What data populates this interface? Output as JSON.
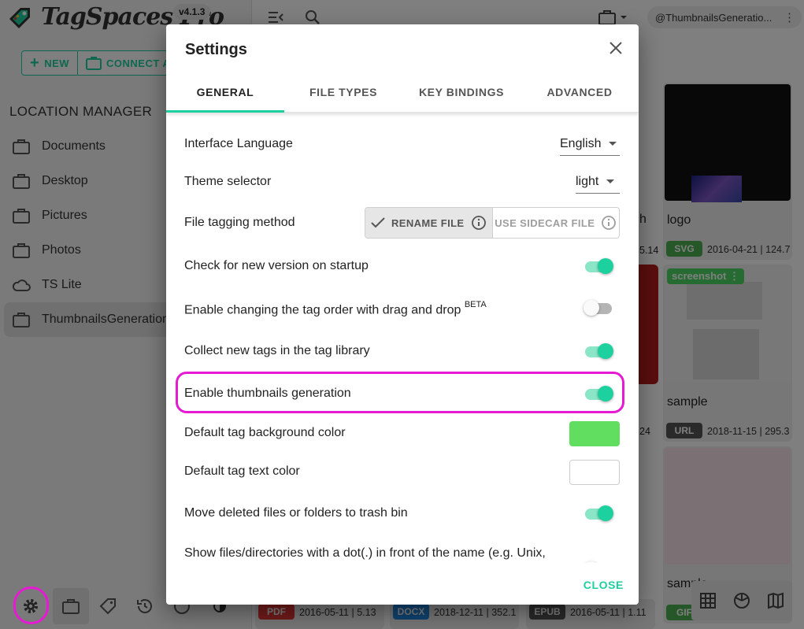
{
  "app": {
    "brand": "TagSpaces Pro",
    "version": "v4.1.3",
    "new_label": "NEW",
    "connect_label": "CONNECT A",
    "location_manager_title": "LOCATION MANAGER",
    "locations": [
      {
        "label": "Documents",
        "icon": "folder-icon"
      },
      {
        "label": "Desktop",
        "icon": "folder-icon"
      },
      {
        "label": "Pictures",
        "icon": "folder-icon"
      },
      {
        "label": "Photos",
        "icon": "folder-icon"
      },
      {
        "label": "TS Lite",
        "icon": "cloud-icon"
      },
      {
        "label": "ThumbnailsGeneration",
        "icon": "folder-icon",
        "active": true
      }
    ],
    "current_location_chip": "@ThumbnailsGeneratio...",
    "accent_color": "#1dd19f"
  },
  "grid": {
    "cards": [
      {
        "title": "logo",
        "ext": "SVG",
        "ext_color": "#4caf50",
        "meta": "2016-04-21 | 124.7"
      },
      {
        "title": "sample",
        "ext": "URL",
        "ext_color": "#555555",
        "meta": "2018-11-15 | 295.3",
        "tag": "screenshot ⋮"
      },
      {
        "title": "sample",
        "ext": "GIF",
        "ext_color": "#4caf50"
      }
    ],
    "partial_texts": {
      "h": "h",
      "s14": "5.14",
      "n24": "24"
    },
    "bottom_row": [
      {
        "ext": "PDF",
        "ext_color": "#e53935",
        "meta": "2016-05-11 | 5.13"
      },
      {
        "ext": "DOCX",
        "ext_color": "#1e88e5",
        "meta": "2018-12-11 | 352.1"
      },
      {
        "ext": "EPUB",
        "ext_color": "#555555",
        "meta": "2016-05-11 | 1.11"
      }
    ]
  },
  "dialog": {
    "title": "Settings",
    "close_label": "CLOSE",
    "tabs": [
      "GENERAL",
      "FILE TYPES",
      "KEY BINDINGS",
      "ADVANCED"
    ],
    "active_tab": "GENERAL",
    "rows": {
      "language": {
        "label": "Interface Language",
        "value": "English"
      },
      "theme": {
        "label": "Theme selector",
        "value": "light"
      },
      "tagging": {
        "label": "File tagging method",
        "option_rename": "RENAME FILE",
        "option_sidecar": "USE SIDECAR FILE",
        "selected": "RENAME FILE"
      },
      "check_version": {
        "label": "Check for new version on startup",
        "on": true
      },
      "tag_order": {
        "label": "Enable changing the tag order with drag and drop",
        "badge": "BETA",
        "on": false
      },
      "collect_tags": {
        "label": "Collect new tags in the tag library",
        "on": true
      },
      "thumbnails": {
        "label": "Enable thumbnails generation",
        "on": true
      },
      "tag_bg": {
        "label": "Default tag background color",
        "color": "#61dd5f"
      },
      "tag_text": {
        "label": "Default tag text color",
        "color": "#ffffff"
      },
      "trash": {
        "label": "Move deleted files or folders to trash bin",
        "on": true
      },
      "dotfiles": {
        "label": "Show files/directories with a dot(.) in front of the name (e.g. Unix,",
        "on": false
      }
    }
  }
}
